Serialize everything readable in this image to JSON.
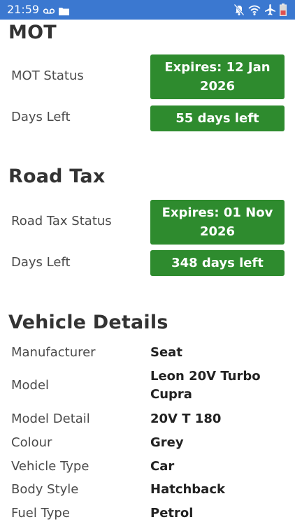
{
  "status_bar": {
    "time": "21:59",
    "icons_left": [
      "voicemail-icon",
      "folder-icon"
    ],
    "icons_right": [
      "mute-icon",
      "wifi-icon",
      "airplane-icon",
      "battery-low-icon"
    ]
  },
  "mot": {
    "heading": "MOT",
    "status_label": "MOT Status",
    "status_value": "Expires: 12 Jan 2026",
    "days_label": "Days Left",
    "days_value": "55 days left"
  },
  "road_tax": {
    "heading": "Road Tax",
    "status_label": "Road Tax Status",
    "status_value": "Expires: 01 Nov 2026",
    "days_label": "Days Left",
    "days_value": "348 days left"
  },
  "vehicle_details": {
    "heading": "Vehicle Details",
    "rows": [
      {
        "label": "Manufacturer",
        "value": "Seat"
      },
      {
        "label": "Model",
        "value": "Leon 20V Turbo Cupra"
      },
      {
        "label": "Model Detail",
        "value": "20V T 180"
      },
      {
        "label": "Colour",
        "value": "Grey"
      },
      {
        "label": "Vehicle Type",
        "value": "Car"
      },
      {
        "label": "Body Style",
        "value": "Hatchback"
      },
      {
        "label": "Fuel Type",
        "value": "Petrol"
      }
    ]
  },
  "colors": {
    "status_bar": "#3b78d0",
    "badge_green": "#2e8b2e",
    "battery_low": "#e05050"
  }
}
